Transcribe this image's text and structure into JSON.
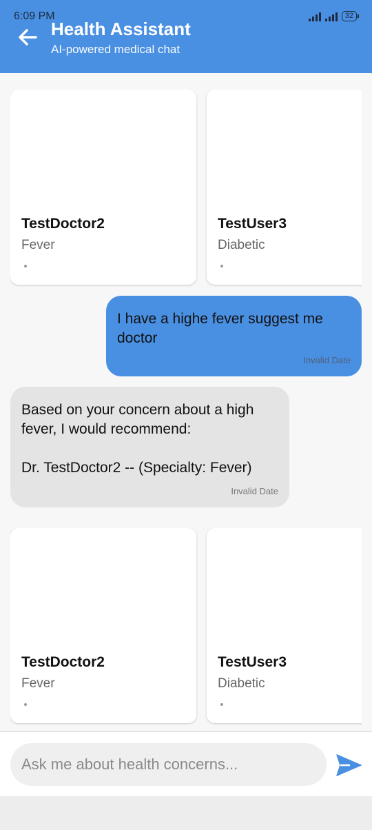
{
  "status_bar": {
    "time": "6:09 PM",
    "battery": "32"
  },
  "header": {
    "title": "Health Assistant",
    "subtitle": "AI-powered medical chat"
  },
  "doctor_rows": [
    {
      "cards": [
        {
          "name": "TestDoctor2",
          "specialty": "Fever",
          "dot": "•"
        },
        {
          "name": "TestUser3",
          "specialty": "Diabetic",
          "dot": "•"
        }
      ]
    },
    {
      "cards": [
        {
          "name": "TestDoctor2",
          "specialty": "Fever",
          "dot": "•"
        },
        {
          "name": "TestUser3",
          "specialty": "Diabetic",
          "dot": "•"
        }
      ]
    }
  ],
  "messages": [
    {
      "sender": "user",
      "text": "I have a highe fever suggest me doctor",
      "timestamp": "Invalid Date"
    },
    {
      "sender": "bot",
      "text": "Based on your concern about a high fever, I would recommend:\n\nDr. TestDoctor2 -- (Specialty: Fever)",
      "timestamp": "Invalid Date"
    }
  ],
  "input": {
    "placeholder": "Ask me about health concerns...",
    "value": ""
  },
  "colors": {
    "primary": "#4a90e2",
    "bot_bubble": "#e4e4e4",
    "background": "#f7f7f7"
  },
  "icons": {
    "back": "arrow-left-icon",
    "send": "send-icon"
  }
}
